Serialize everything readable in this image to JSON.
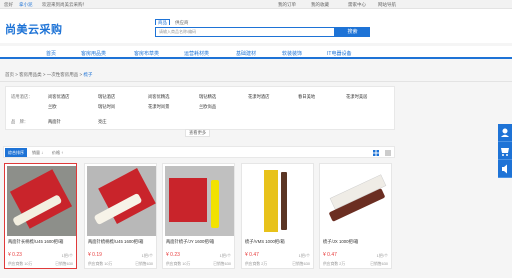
{
  "topbar": {
    "greeting": "您好",
    "user": "拿小泥",
    "welcome": "欢迎来到尚美云采购！",
    "orders": "我的订单",
    "favorites": "我的收藏",
    "center": "需家中心",
    "nav_link": "网站导航"
  },
  "header": {
    "logo": "尚美云采购",
    "tab_goods": "商品",
    "tab_shop": "供应商",
    "search_placeholder": "请输入商品名称/编码",
    "search_button": "搜索"
  },
  "nav": {
    "items": [
      "首页",
      "客房用品类",
      "客房布草类",
      "运营耗材类",
      "基础建材",
      "软装装饰",
      "IT电器设备"
    ]
  },
  "breadcrumb": {
    "items": [
      "首页",
      "客房用品类",
      "一次性客房用品"
    ],
    "current": "梳子"
  },
  "filter": {
    "brand_label": "适用酒店：",
    "brands": [
      "尚客优酒店",
      "瑞钻酒店",
      "尚客优精选",
      "瑞钻精选",
      "花漾时酒店",
      "春日美地",
      "花漾时美居",
      "兰欧",
      "瑞钻时尚",
      "花漾时尚景",
      "兰欧尚品"
    ],
    "material_label": "品　牌：",
    "materials": [
      "两面针",
      "亮庄"
    ],
    "more": "查看更多"
  },
  "sortbar": {
    "active": "综合排序",
    "sales": "销量 ↓",
    "price": "价格 ↑"
  },
  "products": [
    {
      "name": "两面针长柄梳/U45 1600把/箱",
      "price": "¥ 0.23",
      "unit": "1把/个",
      "sold": "供应商数 10万",
      "stock": "已销售630"
    },
    {
      "name": "两面针梳柄梳/U45 1600把/箱",
      "price": "¥ 0.19",
      "unit": "1把/个",
      "sold": "供应商数 10万",
      "stock": "已销售630"
    },
    {
      "name": "两面针梳子/JY 1600把/箱",
      "price": "¥ 0.23",
      "unit": "1把/个",
      "sold": "供应商数 10万",
      "stock": "已销售630"
    },
    {
      "name": "梳子/VMS 1000把/箱",
      "price": "¥ 0.47",
      "unit": "1把/个",
      "sold": "供应商数 2万",
      "stock": "已销售630"
    },
    {
      "name": "梳子/JX 1000把/箱",
      "price": "¥ 0.47",
      "unit": "1把/个",
      "sold": "供应商数 2万",
      "stock": "已销售630"
    }
  ],
  "colors": {
    "brand": "#1e73d6",
    "price": "#e83f3f",
    "selected_border": "#e03a3a"
  }
}
